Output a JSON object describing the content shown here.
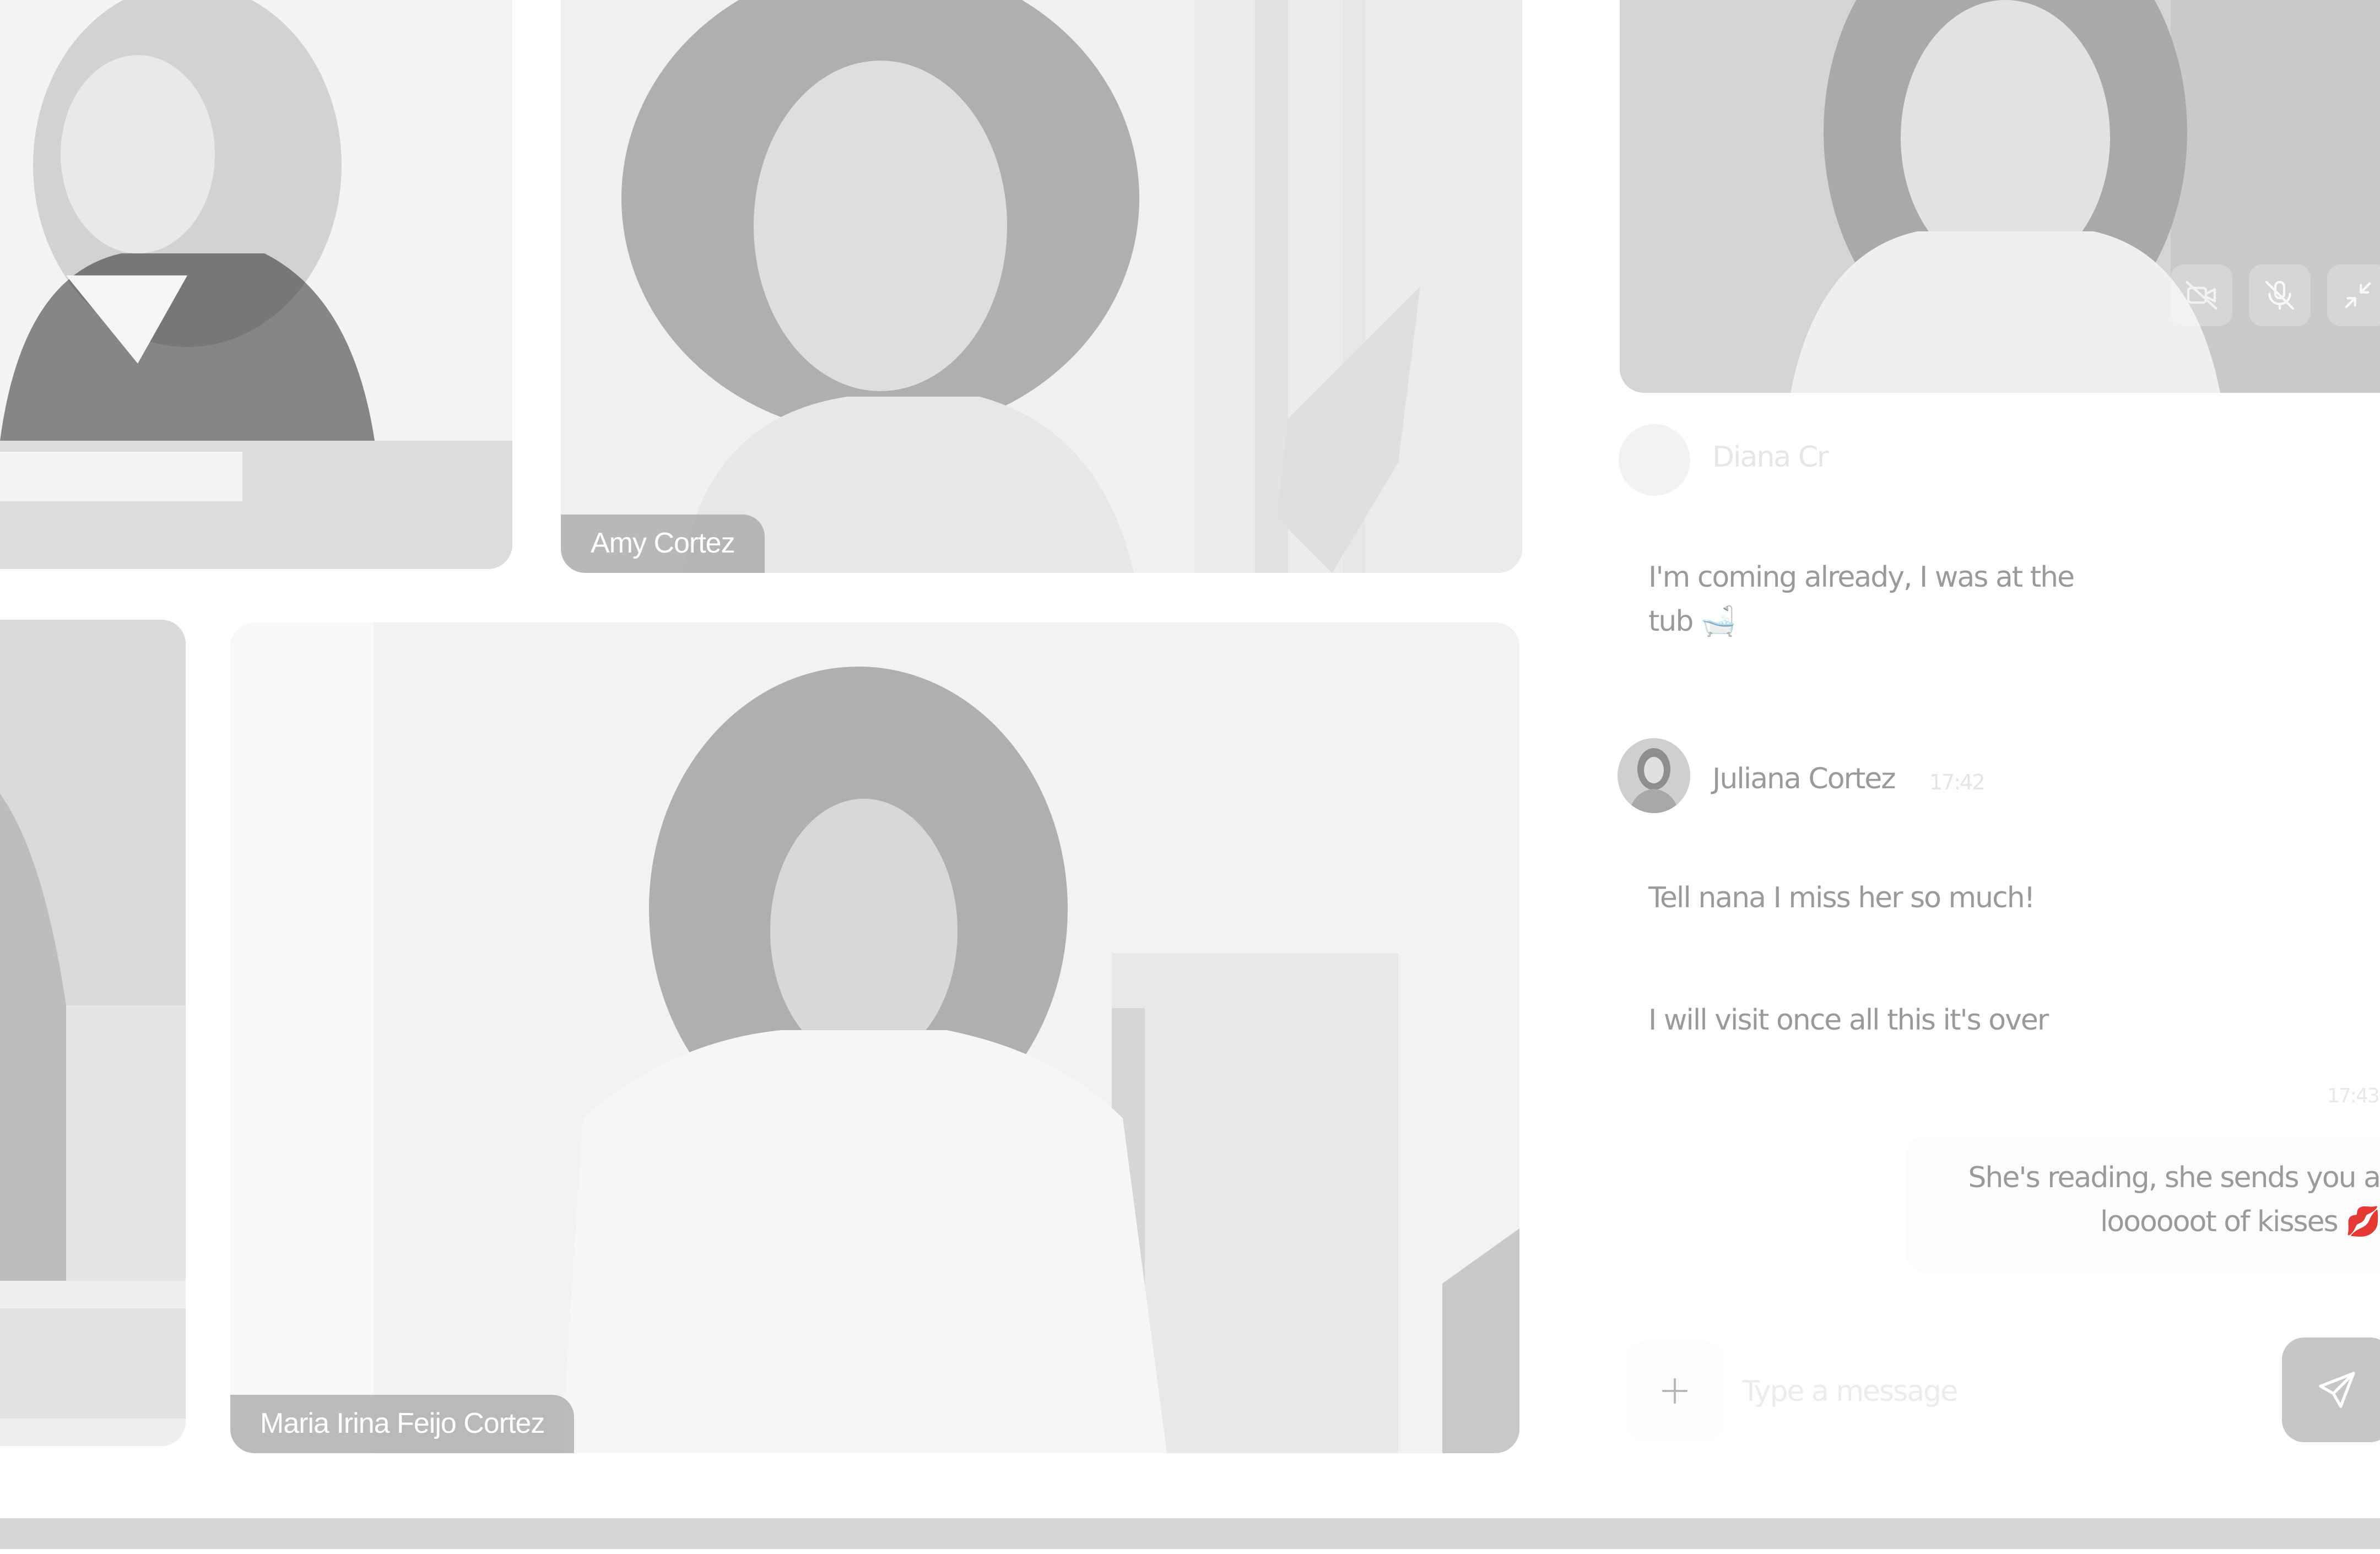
{
  "participants": [
    {
      "name": "Amy Cortez"
    },
    {
      "name": "Maria Irina Feijo Cortez"
    }
  ],
  "chat": {
    "faded_sender": "Diana Cr",
    "messages": [
      {
        "text_line1": "I'm coming already, I was at the",
        "text_line2": "tub 🛁"
      },
      {
        "sender": "Juliana Cortez",
        "time": "17:42"
      },
      {
        "text": "Tell nana I miss her so much!"
      },
      {
        "text": "I will visit once all this it's over"
      },
      {
        "time": "17:43"
      },
      {
        "text_line1": "She's reading, she sends you a",
        "text_line2": "loooooot of kisses 💋"
      }
    ],
    "input_placeholder": "Type a message"
  },
  "colors": {
    "text": "#9a9a9a",
    "background": "#ffffff"
  },
  "icons": [
    "camera-off-icon",
    "mic-off-icon",
    "collapse-icon",
    "plus-icon",
    "send-icon"
  ]
}
